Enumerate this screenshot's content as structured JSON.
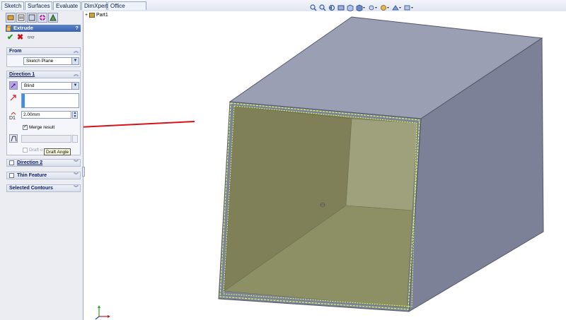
{
  "command_tabs": [
    "Sketch",
    "Surfaces",
    "Evaluate",
    "DimXpert",
    "Office Products"
  ],
  "tree": {
    "root_label": "Part1"
  },
  "property_manager": {
    "title": "Extrude",
    "help": "?",
    "ok_icon": "check-icon",
    "cancel_icon": "x-icon",
    "preview_icon": "glasses-icon",
    "from": {
      "title": "From",
      "value": "Sketch Plane"
    },
    "direction1": {
      "title": "Direction 1",
      "end_condition": "Blind",
      "depth": "2.00mm",
      "merge_result_label": "Merge result",
      "merge_result_checked": true,
      "draft_label": "Draft o",
      "draft_tooltip": "Draft Angle"
    },
    "direction2": {
      "title": "Direction 2",
      "checked": false
    },
    "thin_feature": {
      "title": "Thin Feature",
      "checked": false
    },
    "selected_contours": {
      "title": "Selected Contours"
    }
  },
  "colors": {
    "box_top": "#9b9fb3",
    "box_right": "#7d8197",
    "box_front_frame": "#7f8398",
    "inner_left_wall": "#7f8057",
    "inner_back_wall": "#9ea17c",
    "inner_floor": "#8d8f64",
    "inner_top_wall": "#86885e",
    "edge_highlight": "#d9ff6a",
    "annotation_arrow": "#d4141a"
  }
}
